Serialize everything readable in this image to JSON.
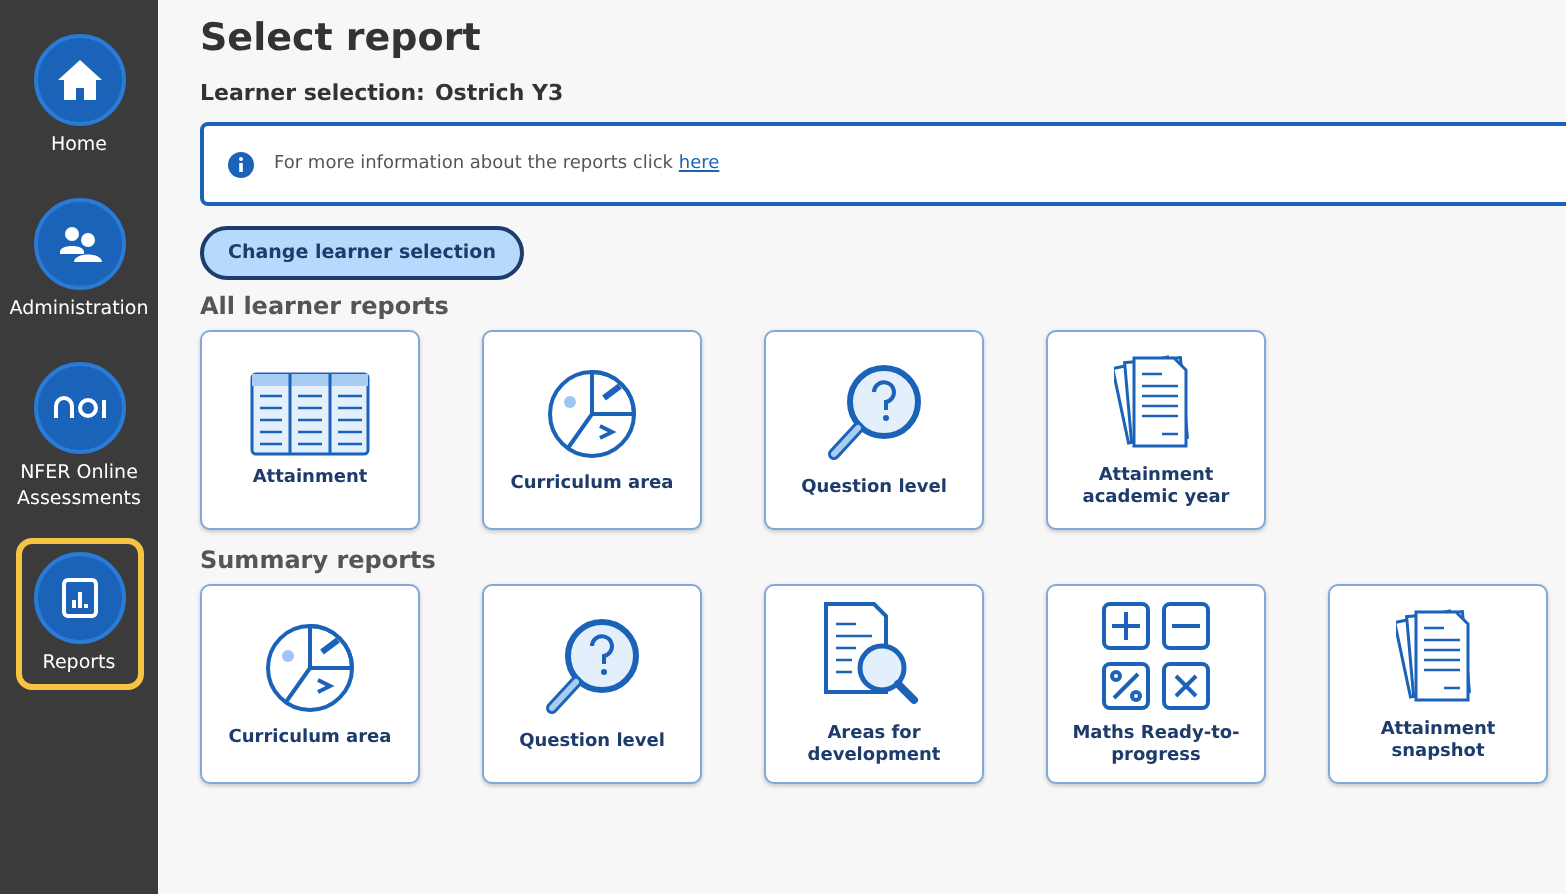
{
  "sidebar": {
    "items": [
      {
        "label": "Home",
        "kind": "home",
        "selected": false
      },
      {
        "label": "Administration",
        "kind": "people",
        "selected": false
      },
      {
        "label": "NFER Online Assessments",
        "kind": "noa",
        "selected": false
      },
      {
        "label": "Reports",
        "kind": "chart",
        "selected": true
      }
    ]
  },
  "title": "Select report",
  "learner_selection": {
    "label": "Learner selection:",
    "value": "Ostrich Y3"
  },
  "info": {
    "text": "For more information about the reports click",
    "link": "here"
  },
  "change_button": "Change learner selection",
  "sections": [
    {
      "heading": "All learner reports",
      "cards": [
        {
          "label": "Attainment",
          "kind": "table"
        },
        {
          "label": "Curriculum area",
          "kind": "pie"
        },
        {
          "label": "Question level",
          "kind": "magnifier"
        },
        {
          "label": "Attainment academic year",
          "kind": "documents"
        }
      ]
    },
    {
      "heading": "Summary reports",
      "cards": [
        {
          "label": "Curriculum area",
          "kind": "pie"
        },
        {
          "label": "Question level",
          "kind": "magnifier"
        },
        {
          "label": "Areas for development",
          "kind": "docsearch"
        },
        {
          "label": "Maths Ready-to-progress",
          "kind": "maths"
        },
        {
          "label": "Attainment snapshot",
          "kind": "documents"
        }
      ]
    }
  ]
}
